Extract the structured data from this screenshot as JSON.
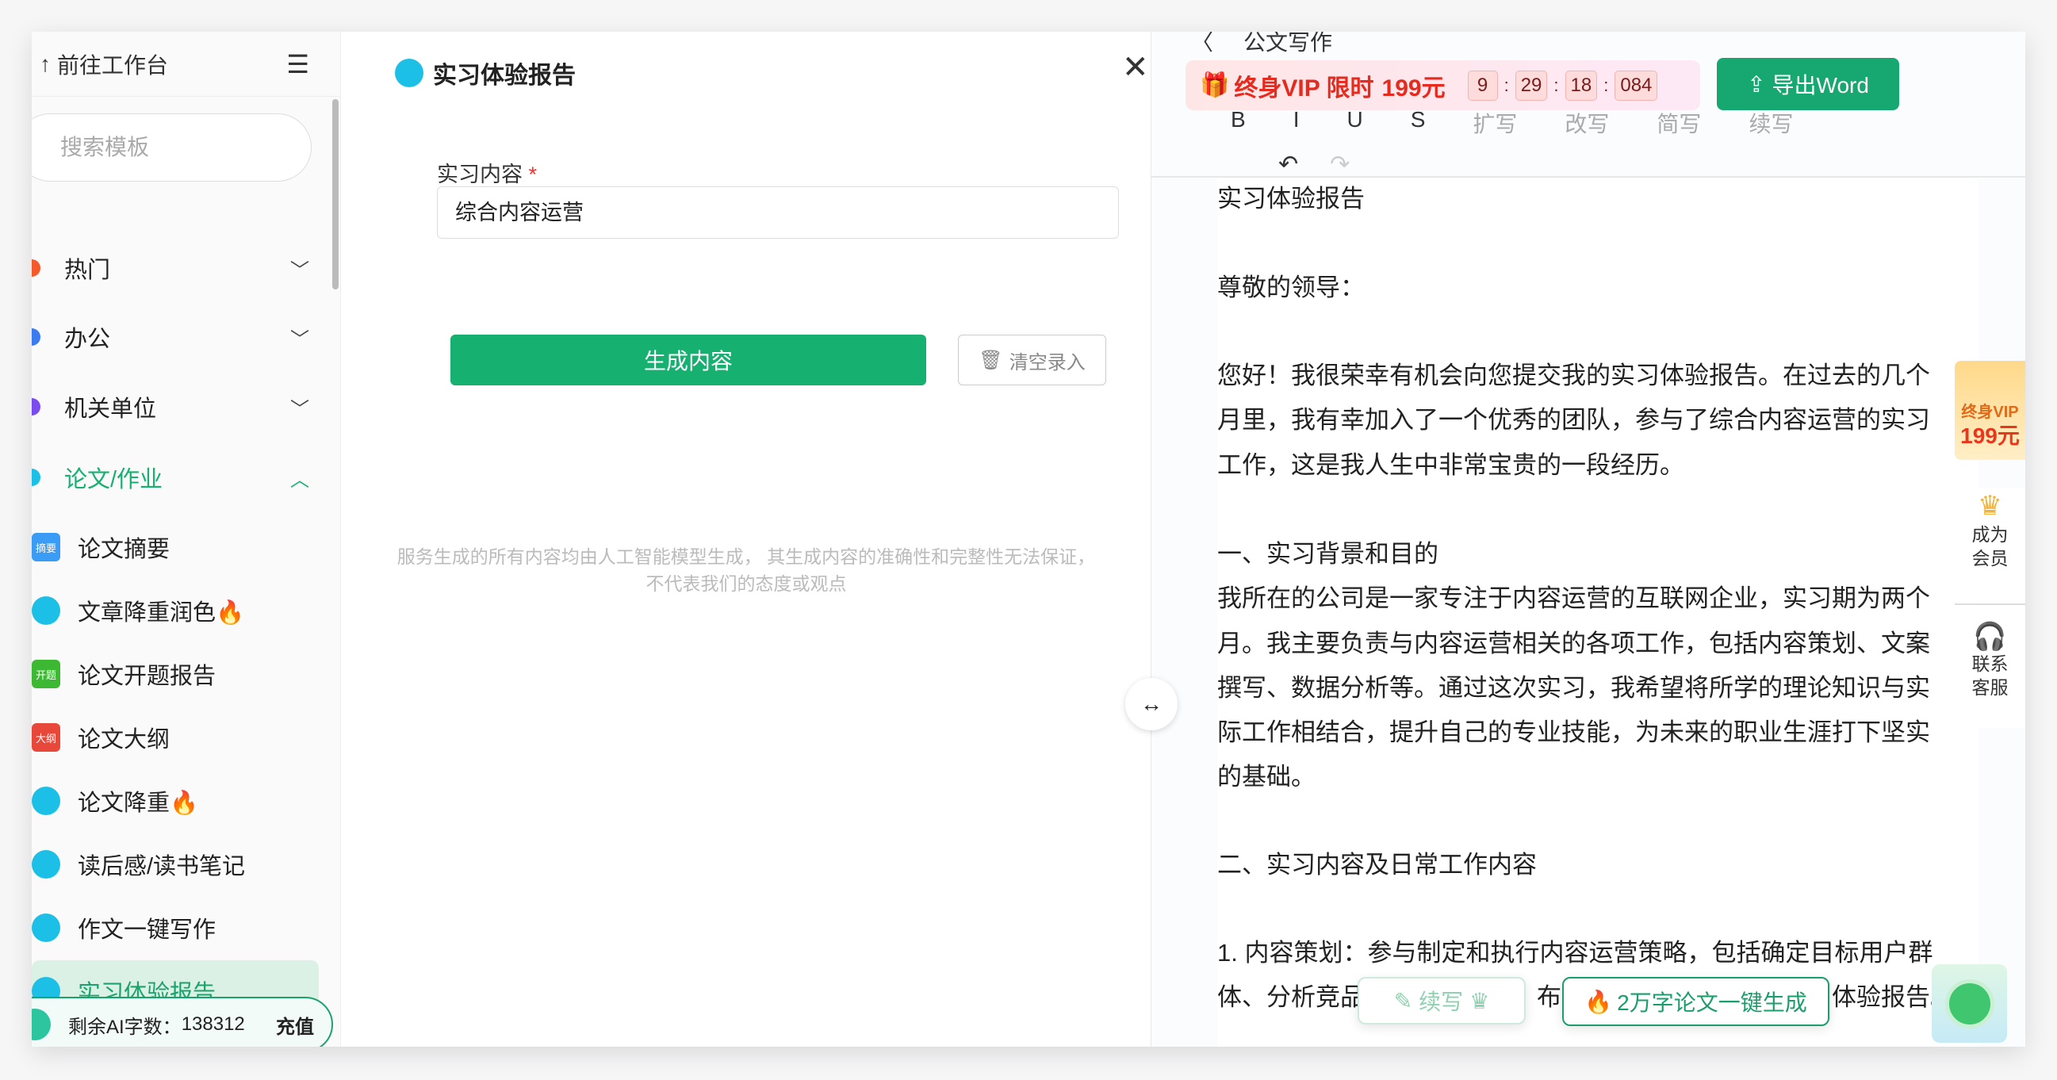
{
  "sidebar": {
    "back_label": "前往工作台",
    "search_placeholder": "搜索模板",
    "categories": [
      {
        "label": "热门",
        "color": "#f35a2c",
        "expanded": false
      },
      {
        "label": "办公",
        "color": "#3a7bf0",
        "expanded": false
      },
      {
        "label": "机关单位",
        "color": "#7a4cf0",
        "expanded": false
      },
      {
        "label": "论文/作业",
        "color": "#1cc0e6",
        "expanded": true
      }
    ],
    "items": [
      {
        "label": "论文摘要",
        "badge": "摘要",
        "badge_color": "#3a9cf5"
      },
      {
        "label": "文章降重润色🔥",
        "badge": "",
        "badge_color": "#1cc0e6"
      },
      {
        "label": "论文开题报告",
        "badge": "开题",
        "badge_color": "#3cb832"
      },
      {
        "label": "论文大纲",
        "badge": "大纲",
        "badge_color": "#e8483a"
      },
      {
        "label": "论文降重🔥",
        "badge": "",
        "badge_color": "#1cc0e6"
      },
      {
        "label": "读后感/读书笔记",
        "badge": "",
        "badge_color": "#1cc0e6"
      },
      {
        "label": "作文一键写作",
        "badge": "",
        "badge_color": "#1cc0e6"
      },
      {
        "label": "实习体验报告",
        "badge": "",
        "badge_color": "#1cc0e6",
        "active": true
      }
    ],
    "remaining_label": "剩余AI字数：",
    "remaining_value": "138312",
    "recharge_label": "充值"
  },
  "form": {
    "title": "实习体验报告",
    "field_label": "实习内容",
    "required_mark": "*",
    "field_value": "综合内容运营",
    "generate_label": "生成内容",
    "clear_label": "清空录入",
    "disclaimer_1": "服务生成的所有内容均由人工智能模型生成， 其生成内容的准确性和完整性无法保证，",
    "disclaimer_2": "不代表我们的态度或观点"
  },
  "editor": {
    "breadcrumb": "公文写作",
    "vip_banner": {
      "text": "终身VIP 限时",
      "price": "199元",
      "countdown": [
        "9",
        "29",
        "18",
        "084"
      ]
    },
    "export_label": "导出Word",
    "toolbar": [
      "B",
      "I",
      "U",
      "S",
      "扩写",
      "改写",
      "简写",
      "续写"
    ],
    "doc_lines": [
      "实习体验报告",
      "",
      "尊敬的领导：",
      "",
      "您好！我很荣幸有机会向您提交我的实习体验报告。在过去的几个",
      "月里，我有幸加入了一个优秀的团队，参与了综合内容运营的实习",
      "工作，这是我人生中非常宝贵的一段经历。",
      "",
      "一、实习背景和目的",
      "我所在的公司是一家专注于内容运营的互联网企业，实习期为两个",
      "月。我主要负责与内容运营相关的各项工作，包括内容策划、文案",
      "撰写、数据分析等。通过这次实习，我希望将所学的理论知识与实",
      "际工作相结合，提升自己的专业技能，为未来的职业生涯打下坚实",
      "的基础。",
      "",
      "二、实习内容及日常工作内容",
      "",
      "1. 内容策划：参与制定和执行内容运营策略，包括确定目标用户群",
      "体、分析竞品　　　　　　　布计　　　　　　　　　　体验报告。"
    ],
    "continue_label": "续写",
    "thesis_label": "2万字论文一键生成"
  },
  "rail": {
    "vip_text": "终身VIP",
    "vip_price": "199元",
    "member_label": "成为会员",
    "service_label": "联系客服"
  },
  "colors": {
    "accent": "#16b070",
    "vip_red": "#e62a1d"
  }
}
